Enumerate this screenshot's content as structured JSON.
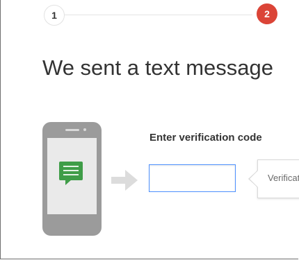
{
  "steps": {
    "step1_number": "1",
    "step2_number": "2",
    "active_color": "#db4437"
  },
  "heading": {
    "text": "We sent a text message"
  },
  "illustration": {
    "phone_icon": "smartphone-icon",
    "message_icon": "chat-bubble-icon",
    "arrow_icon": "arrow-right-icon",
    "message_color": "#3f9d48"
  },
  "form": {
    "code_label": "Enter verification code",
    "code_value": "",
    "focus_color": "#4d90fe"
  },
  "tooltip": {
    "text": "Verification code"
  }
}
